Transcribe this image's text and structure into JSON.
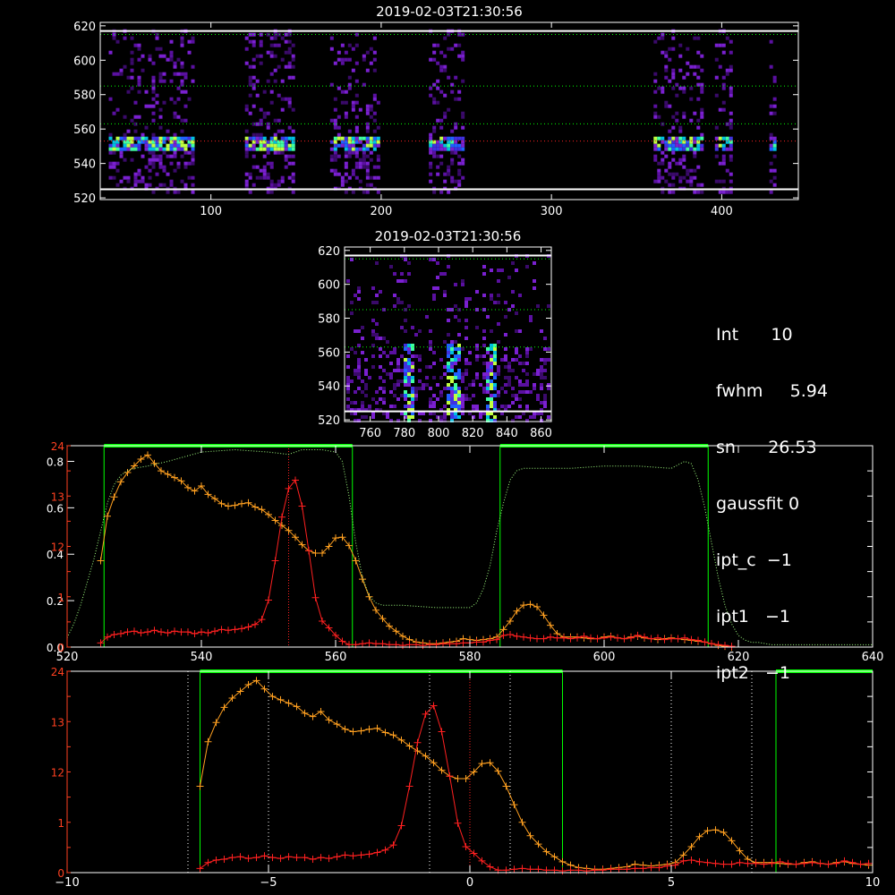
{
  "info": {
    "lines": [
      {
        "label": "Int",
        "value": "10"
      },
      {
        "label": "fwhm",
        "value": "5.94"
      },
      {
        "label": "sn",
        "value": "26.53"
      },
      {
        "label": "gaussfit",
        "value": "0"
      },
      {
        "label": "ipt_c",
        "value": "−1"
      },
      {
        "label": "ipt1",
        "value": "−1"
      },
      {
        "label": "ipt2",
        "value": "−1"
      }
    ]
  },
  "colors": {
    "axis": "#ffffff",
    "yellow": "#ffa020",
    "red": "#ff2020",
    "green": "#00ff00",
    "dotted_green": "#a0ff80",
    "red_axis": "#ff4020"
  },
  "chart_data": [
    {
      "type": "heatmap",
      "title": "2019-02-03T21:30:56",
      "xlim": [
        35,
        445
      ],
      "ylim": [
        519,
        622
      ],
      "xticks": [
        100,
        200,
        300,
        400
      ],
      "yticks": [
        520,
        540,
        560,
        580,
        600,
        620
      ],
      "bands": [
        [
          40,
          90
        ],
        [
          120,
          148
        ],
        [
          170,
          198
        ],
        [
          228,
          248
        ],
        [
          360,
          388
        ],
        [
          396,
          406
        ],
        [
          428,
          432
        ]
      ],
      "bright_row": 552,
      "hlines": [
        {
          "y": 617,
          "color": "#ffffff"
        },
        {
          "y": 525,
          "color": "#ffffff"
        },
        {
          "y": 615,
          "color": "#00ff00"
        },
        {
          "y": 585,
          "color": "#00ff00"
        },
        {
          "y": 563,
          "color": "#00ff00"
        },
        {
          "y": 553,
          "color": "#ff2020"
        }
      ]
    },
    {
      "type": "heatmap",
      "title": "2019-02-03T21:30:56",
      "xlim": [
        745,
        866
      ],
      "ylim": [
        519,
        622
      ],
      "xticks": [
        760,
        780,
        800,
        820,
        840,
        860
      ],
      "yticks": [
        520,
        540,
        560,
        580,
        600,
        620
      ],
      "streaks": [
        782,
        808,
        830
      ],
      "hlines": [
        {
          "y": 617,
          "color": "#ffffff"
        },
        {
          "y": 525,
          "color": "#ffffff"
        },
        {
          "y": 615,
          "color": "#00ff00"
        },
        {
          "y": 585,
          "color": "#00ff00"
        },
        {
          "y": 563,
          "color": "#00ff00"
        }
      ]
    },
    {
      "type": "line",
      "xlim": [
        520,
        640
      ],
      "xticks": [
        520,
        540,
        560,
        580,
        600,
        620,
        640
      ],
      "yleft_ticks": [
        0.0,
        0.2,
        0.4,
        0.6,
        0.8
      ],
      "yleft_tick_labels": [
        "0.0",
        "0.2",
        "0.4",
        "0.6",
        "0.8"
      ],
      "ylim_left": [
        0,
        0.85
      ],
      "ylim_right": [
        0,
        24
      ],
      "yright_ticks": [
        0,
        3,
        6,
        9,
        12,
        15,
        18,
        21,
        24
      ],
      "red_tick_labels": [
        {
          "v": 0,
          "t": "0"
        },
        {
          "v": 6,
          "t": "1"
        },
        {
          "v": 12,
          "t": "12"
        },
        {
          "v": 18,
          "t": "13"
        },
        {
          "v": 24,
          "t": "24"
        }
      ],
      "green_windows": [
        [
          525.5,
          562.5
        ],
        [
          584.5,
          615.5
        ]
      ],
      "red_vline": 553,
      "series": [
        {
          "color": "#ffa020",
          "x": [
            525,
            526,
            527,
            528,
            529,
            530,
            531,
            532,
            533,
            534,
            535,
            536,
            537,
            538,
            539,
            540,
            541,
            542,
            543,
            544,
            545,
            546,
            547,
            548,
            549,
            550,
            551,
            552,
            553,
            554,
            555,
            556,
            557,
            558,
            559,
            560,
            561,
            562,
            563,
            564,
            565,
            566,
            567,
            568,
            569,
            570,
            571,
            572,
            573,
            574,
            575,
            576,
            577,
            578,
            579,
            580,
            581,
            582,
            583,
            584,
            585,
            586,
            587,
            588,
            589,
            590,
            591,
            592,
            593,
            594,
            595,
            596,
            597,
            598,
            599,
            600,
            601,
            602,
            603,
            604,
            605,
            606,
            607,
            608,
            609,
            610,
            611,
            612,
            613,
            614,
            615,
            616,
            617,
            618,
            619
          ],
          "y": [
            10.3,
            15.6,
            17.9,
            19.7,
            20.8,
            21.6,
            22.4,
            22.9,
            21.9,
            21.0,
            20.6,
            20.2,
            19.8,
            19.0,
            18.6,
            19.2,
            18.2,
            17.7,
            17.1,
            16.8,
            16.9,
            17.1,
            17.2,
            16.7,
            16.4,
            15.8,
            15.1,
            14.5,
            13.9,
            13.1,
            12.2,
            11.5,
            11.2,
            11.2,
            12.0,
            13.0,
            13.1,
            12.1,
            10.3,
            8.1,
            6.0,
            4.4,
            3.4,
            2.5,
            1.9,
            1.3,
            0.9,
            0.6,
            0.5,
            0.4,
            0.4,
            0.5,
            0.6,
            0.7,
            1.0,
            0.9,
            0.8,
            0.9,
            1.0,
            1.2,
            2.1,
            3.1,
            4.3,
            5.0,
            5.1,
            4.8,
            3.8,
            2.6,
            1.6,
            1.2,
            1.2,
            1.2,
            1.1,
            1.0,
            1.0,
            1.2,
            1.3,
            1.1,
            1.0,
            1.2,
            1.3,
            1.1,
            1.0,
            0.9,
            1.0,
            1.1,
            1.0,
            0.9,
            0.8,
            0.7,
            0.6,
            0.4,
            0.2,
            0.1,
            0.0
          ]
        },
        {
          "color": "#ff2020",
          "x": [
            525,
            526,
            527,
            528,
            529,
            530,
            531,
            532,
            533,
            534,
            535,
            536,
            537,
            538,
            539,
            540,
            541,
            542,
            543,
            544,
            545,
            546,
            547,
            548,
            549,
            550,
            551,
            552,
            553,
            554,
            555,
            556,
            557,
            558,
            559,
            560,
            561,
            562,
            563,
            564,
            565,
            566,
            567,
            568,
            569,
            570,
            571,
            572,
            573,
            574,
            575,
            576,
            577,
            578,
            579,
            580,
            581,
            582,
            583,
            584,
            585,
            586,
            587,
            588,
            589,
            590,
            591,
            592,
            593,
            594,
            595,
            596,
            597,
            598,
            599,
            600,
            601,
            602,
            603,
            604,
            605,
            606,
            607,
            608,
            609,
            610,
            611,
            612,
            613,
            614,
            615,
            616,
            617,
            618,
            619
          ],
          "y": [
            0.5,
            1.2,
            1.5,
            1.6,
            1.8,
            1.9,
            1.7,
            1.8,
            2.0,
            1.8,
            1.7,
            1.9,
            1.8,
            1.8,
            1.6,
            1.8,
            1.7,
            1.9,
            2.1,
            2.0,
            2.1,
            2.2,
            2.4,
            2.7,
            3.3,
            5.6,
            10.3,
            15.5,
            18.9,
            19.9,
            16.8,
            11.5,
            5.9,
            3.1,
            2.3,
            1.4,
            0.7,
            0.3,
            0.3,
            0.4,
            0.5,
            0.4,
            0.4,
            0.3,
            0.3,
            0.2,
            0.3,
            0.3,
            0.2,
            0.3,
            0.3,
            0.4,
            0.4,
            0.4,
            0.5,
            0.5,
            0.6,
            0.6,
            0.8,
            0.9,
            1.4,
            1.5,
            1.3,
            1.2,
            1.1,
            1.0,
            1.0,
            1.2,
            1.1,
            1.1,
            1.0,
            1.1,
            1.3,
            1.1,
            1.0,
            1.1,
            1.2,
            1.1,
            1.0,
            1.1,
            1.4,
            1.2,
            1.0,
            1.1,
            0.9,
            1.0,
            1.0,
            1.1,
            0.9,
            0.8,
            0.6,
            0.4,
            0.3,
            0.2,
            0.1
          ]
        },
        {
          "color": "#a0ff80",
          "dotted": true,
          "x": [
            520,
            521,
            522,
            523,
            524,
            525,
            526,
            527,
            528,
            529,
            530,
            532,
            535,
            540,
            545,
            550,
            553,
            555,
            558,
            560,
            561,
            562,
            563,
            564,
            565,
            566,
            567,
            568,
            570,
            575,
            580,
            581,
            582,
            583,
            584,
            585,
            586,
            587,
            588,
            590,
            595,
            600,
            605,
            610,
            612,
            613,
            614,
            615,
            616,
            617,
            618,
            619,
            620,
            621,
            622,
            623,
            625,
            630,
            635,
            640
          ],
          "y": [
            0.04,
            0.1,
            0.18,
            0.28,
            0.38,
            0.5,
            0.62,
            0.7,
            0.74,
            0.76,
            0.77,
            0.78,
            0.8,
            0.84,
            0.85,
            0.84,
            0.83,
            0.85,
            0.85,
            0.84,
            0.8,
            0.65,
            0.45,
            0.3,
            0.22,
            0.19,
            0.18,
            0.18,
            0.18,
            0.17,
            0.17,
            0.19,
            0.25,
            0.35,
            0.5,
            0.62,
            0.72,
            0.76,
            0.77,
            0.77,
            0.77,
            0.78,
            0.78,
            0.77,
            0.8,
            0.79,
            0.72,
            0.6,
            0.45,
            0.3,
            0.18,
            0.1,
            0.05,
            0.03,
            0.02,
            0.02,
            0.01,
            0.01,
            0.01,
            0.01
          ]
        }
      ]
    },
    {
      "type": "line",
      "xlim": [
        -10,
        10
      ],
      "xticks": [
        -10,
        -5,
        0,
        5,
        10
      ],
      "ylim": [
        0,
        24
      ],
      "red_tick_labels": [
        {
          "v": 0,
          "t": "0"
        },
        {
          "v": 6,
          "t": "1"
        },
        {
          "v": 12,
          "t": "12"
        },
        {
          "v": 18,
          "t": "13"
        },
        {
          "v": 24,
          "t": "24"
        }
      ],
      "green_windows": [
        [
          -6.7,
          2.3
        ],
        [
          7.6,
          10
        ]
      ],
      "white_vlines": [
        -7,
        -5,
        -1,
        1,
        5,
        7
      ],
      "red_vline": 0,
      "series": [
        {
          "color": "#ffa020",
          "x": [
            -6.7,
            -6.5,
            -6.3,
            -6.1,
            -5.9,
            -5.7,
            -5.5,
            -5.3,
            -5.1,
            -4.9,
            -4.7,
            -4.5,
            -4.3,
            -4.1,
            -3.9,
            -3.7,
            -3.5,
            -3.3,
            -3.1,
            -2.9,
            -2.7,
            -2.5,
            -2.3,
            -2.1,
            -1.9,
            -1.7,
            -1.5,
            -1.3,
            -1.1,
            -0.9,
            -0.7,
            -0.5,
            -0.3,
            -0.1,
            0.1,
            0.3,
            0.5,
            0.7,
            0.9,
            1.1,
            1.3,
            1.5,
            1.7,
            1.9,
            2.1,
            2.3,
            2.5,
            2.7,
            2.9,
            3.1,
            3.3,
            3.5,
            3.7,
            3.9,
            4.1,
            4.3,
            4.5,
            4.7,
            4.9,
            5.1,
            5.3,
            5.5,
            5.7,
            5.9,
            6.1,
            6.3,
            6.5,
            6.7,
            6.9,
            7.1,
            7.3,
            7.5,
            7.7,
            7.9,
            8.1,
            8.3,
            8.5,
            8.7,
            8.9,
            9.1,
            9.3,
            9.5,
            9.7,
            9.9
          ],
          "y": [
            10.3,
            15.6,
            17.9,
            19.7,
            20.8,
            21.6,
            22.4,
            22.9,
            21.9,
            21.0,
            20.6,
            20.2,
            19.8,
            19.0,
            18.6,
            19.2,
            18.2,
            17.7,
            17.1,
            16.8,
            16.9,
            17.1,
            17.2,
            16.7,
            16.4,
            15.8,
            15.1,
            14.5,
            13.9,
            13.1,
            12.2,
            11.5,
            11.2,
            11.2,
            12.0,
            13.0,
            13.1,
            12.1,
            10.3,
            8.1,
            6.0,
            4.4,
            3.4,
            2.5,
            1.9,
            1.3,
            0.9,
            0.6,
            0.5,
            0.4,
            0.4,
            0.5,
            0.6,
            0.7,
            1.0,
            0.9,
            0.8,
            0.9,
            1.0,
            1.2,
            2.1,
            3.1,
            4.3,
            5.0,
            5.1,
            4.8,
            3.8,
            2.6,
            1.6,
            1.2,
            1.2,
            1.2,
            1.1,
            1.0,
            1.0,
            1.2,
            1.3,
            1.1,
            1.0,
            1.2,
            1.3,
            1.1,
            1.0,
            0.9
          ]
        },
        {
          "color": "#ff2020",
          "x": [
            -6.7,
            -6.5,
            -6.3,
            -6.1,
            -5.9,
            -5.7,
            -5.5,
            -5.3,
            -5.1,
            -4.9,
            -4.7,
            -4.5,
            -4.3,
            -4.1,
            -3.9,
            -3.7,
            -3.5,
            -3.3,
            -3.1,
            -2.9,
            -2.7,
            -2.5,
            -2.3,
            -2.1,
            -1.9,
            -1.7,
            -1.5,
            -1.3,
            -1.1,
            -0.9,
            -0.7,
            -0.5,
            -0.3,
            -0.1,
            0.1,
            0.3,
            0.5,
            0.7,
            0.9,
            1.1,
            1.3,
            1.5,
            1.7,
            1.9,
            2.1,
            2.3,
            2.5,
            2.7,
            2.9,
            3.1,
            3.3,
            3.5,
            3.7,
            3.9,
            4.1,
            4.3,
            4.5,
            4.7,
            4.9,
            5.1,
            5.3,
            5.5,
            5.7,
            5.9,
            6.1,
            6.3,
            6.5,
            6.7,
            6.9,
            7.1,
            7.3,
            7.5,
            7.7,
            7.9,
            8.1,
            8.3,
            8.5,
            8.7,
            8.9,
            9.1,
            9.3,
            9.5,
            9.7,
            9.9
          ],
          "y": [
            0.5,
            1.2,
            1.5,
            1.6,
            1.8,
            1.9,
            1.7,
            1.8,
            2.0,
            1.8,
            1.7,
            1.9,
            1.8,
            1.8,
            1.6,
            1.8,
            1.7,
            1.9,
            2.1,
            2.0,
            2.1,
            2.2,
            2.4,
            2.7,
            3.3,
            5.6,
            10.3,
            15.5,
            18.9,
            19.9,
            16.8,
            11.5,
            5.9,
            3.1,
            2.3,
            1.4,
            0.7,
            0.3,
            0.3,
            0.4,
            0.5,
            0.4,
            0.4,
            0.3,
            0.3,
            0.2,
            0.3,
            0.3,
            0.2,
            0.3,
            0.3,
            0.4,
            0.4,
            0.4,
            0.5,
            0.5,
            0.6,
            0.6,
            0.8,
            0.9,
            1.4,
            1.5,
            1.3,
            1.2,
            1.1,
            1.0,
            1.0,
            1.2,
            1.1,
            1.1,
            1.0,
            1.1,
            1.3,
            1.1,
            1.0,
            1.1,
            1.2,
            1.1,
            1.0,
            1.1,
            1.4,
            1.2,
            1.0,
            1.1
          ]
        }
      ]
    }
  ]
}
